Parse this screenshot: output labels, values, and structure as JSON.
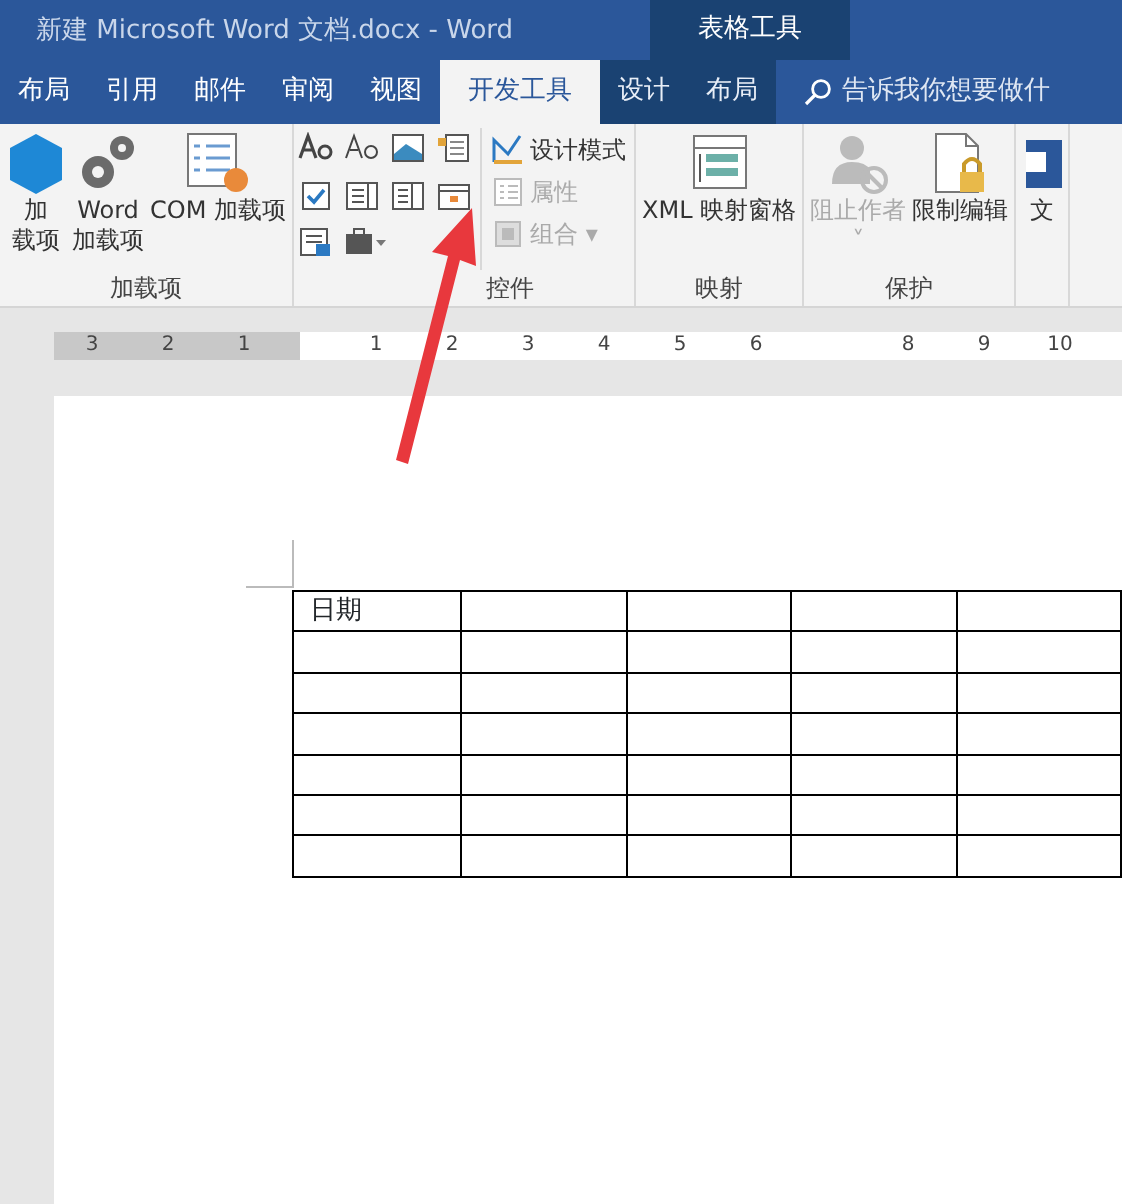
{
  "window": {
    "title": "新建 Microsoft Word 文档.docx  -  Word",
    "context_title": "表格工具"
  },
  "tabs": [
    {
      "label": "布局",
      "selected": false,
      "context": false
    },
    {
      "label": "引用",
      "selected": false,
      "context": false
    },
    {
      "label": "邮件",
      "selected": false,
      "context": false
    },
    {
      "label": "审阅",
      "selected": false,
      "context": false
    },
    {
      "label": "视图",
      "selected": false,
      "context": false
    },
    {
      "label": "开发工具",
      "selected": true,
      "context": false
    },
    {
      "label": "设计",
      "selected": false,
      "context": true
    },
    {
      "label": "布局",
      "selected": false,
      "context": true
    }
  ],
  "search": {
    "placeholder": "告诉我你想要做什"
  },
  "ribbon_groups": [
    {
      "label": "加载项",
      "items": [
        {
          "kind": "big",
          "lines": [
            "加",
            "载项"
          ],
          "disabled": false
        },
        {
          "kind": "big",
          "lines": [
            "Word",
            "加载项"
          ],
          "disabled": false
        },
        {
          "kind": "big",
          "lines": [
            "COM 加载项"
          ],
          "disabled": false
        }
      ]
    },
    {
      "label": "控件",
      "items": [
        {
          "kind": "grid"
        },
        {
          "kind": "small",
          "label": "设计模式",
          "disabled": false
        },
        {
          "kind": "small",
          "label": "属性",
          "disabled": true
        },
        {
          "kind": "small",
          "label": "组合 ▾",
          "disabled": true
        }
      ]
    },
    {
      "label": "映射",
      "items": [
        {
          "kind": "big",
          "lines": [
            "XML 映射窗格"
          ],
          "disabled": false
        }
      ]
    },
    {
      "label": "保护",
      "items": [
        {
          "kind": "big",
          "lines": [
            "阻止作者",
            "˅"
          ],
          "disabled": true
        },
        {
          "kind": "big",
          "lines": [
            "限制编辑"
          ],
          "disabled": false
        }
      ]
    },
    {
      "items": [
        {
          "kind": "big",
          "lines": [
            "文"
          ],
          "disabled": false
        }
      ]
    }
  ],
  "ruler": [
    "3",
    "2",
    "1",
    "1",
    "2",
    "3",
    "4",
    "5",
    "6",
    "8",
    "9",
    "10"
  ],
  "table": {
    "rows": [
      [
        "日期",
        "",
        "",
        "",
        ""
      ],
      [
        "",
        "",
        "",
        "",
        ""
      ],
      [
        "",
        "",
        "",
        "",
        ""
      ],
      [
        "",
        "",
        "",
        "",
        ""
      ],
      [
        "",
        "",
        "",
        "",
        ""
      ],
      [
        "",
        "",
        "",
        "",
        ""
      ],
      [
        "",
        "",
        "",
        "",
        ""
      ]
    ]
  }
}
